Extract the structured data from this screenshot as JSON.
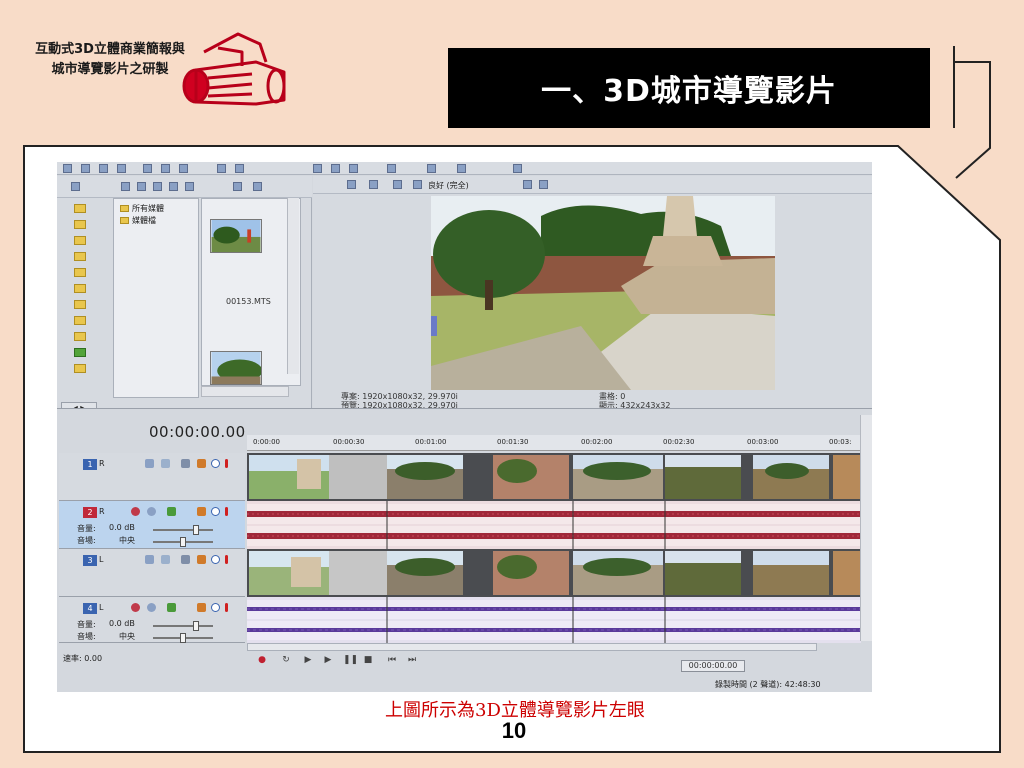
{
  "slide": {
    "logo_line1": "互動式3D立體商業簡報與",
    "logo_line2": "城市導覽影片之研製",
    "title": "一、3D城市導覽影片",
    "caption": "上圖所示為3D立體導覽影片左眼",
    "page_number": "10"
  },
  "vegas": {
    "media_tree": {
      "item1": "所有媒體",
      "item2": "媒體檔"
    },
    "thumb_file": "00153.MTS",
    "preview_quality": "良好 (完全)",
    "project_info": "專案: 1920x1080x32, 29.970i",
    "preview_info": "預覽: 1920x1080x32, 29.970i",
    "frame_info": "畫格: 0",
    "display_info": "顯示: 432x243x32",
    "timecode": "00:00:00.00",
    "ruler": [
      "0:00:00",
      "00:00:30",
      "00:01:00",
      "00:01:30",
      "00:02:00",
      "00:02:30",
      "00:03:00",
      "00:03:"
    ],
    "tracks": [
      {
        "num": "1",
        "chan": "R"
      },
      {
        "num": "2",
        "chan": "R",
        "vol_label": "音量:",
        "vol_value": "0.0 dB",
        "pan_label": "音場:",
        "pan_value": "中央"
      },
      {
        "num": "3",
        "chan": "L"
      },
      {
        "num": "4",
        "chan": "L",
        "vol_label": "音量:",
        "vol_value": "0.0 dB",
        "pan_label": "音場:",
        "pan_value": "中央"
      }
    ],
    "rate": "速率: 0.00",
    "transport_timecode": "00:00:00.00",
    "record_time": "錄製時間 (2 聲道): 42:48:30"
  }
}
